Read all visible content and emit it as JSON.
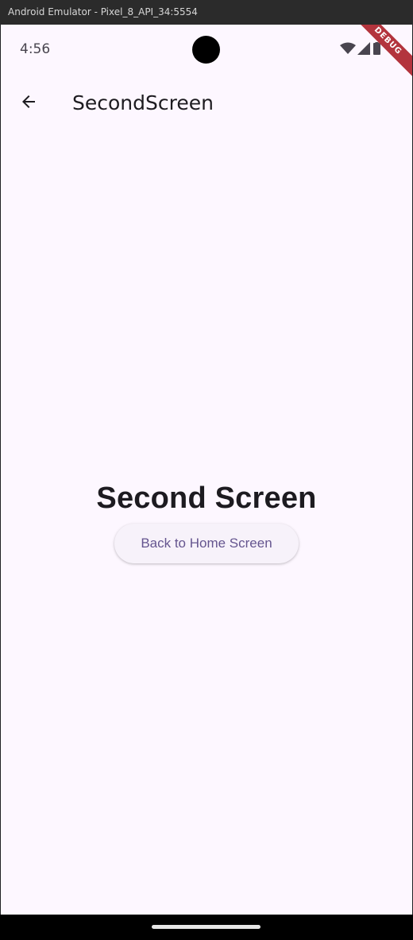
{
  "window": {
    "title": "Android Emulator - Pixel_8_API_34:5554"
  },
  "status_bar": {
    "time": "4:56",
    "icons": [
      "wifi-icon",
      "cell-signal-icon",
      "battery-icon"
    ]
  },
  "debug_banner": {
    "label": "DEBUG"
  },
  "app_bar": {
    "back_icon": "arrow-back-icon",
    "title": "SecondScreen"
  },
  "main": {
    "heading": "Second Screen",
    "button_label": "Back to Home Screen"
  },
  "colors": {
    "background": "#fdf7ff",
    "button_text": "#65558f",
    "button_bg": "#f7f2fa",
    "debug_banner": "#b3343d"
  }
}
